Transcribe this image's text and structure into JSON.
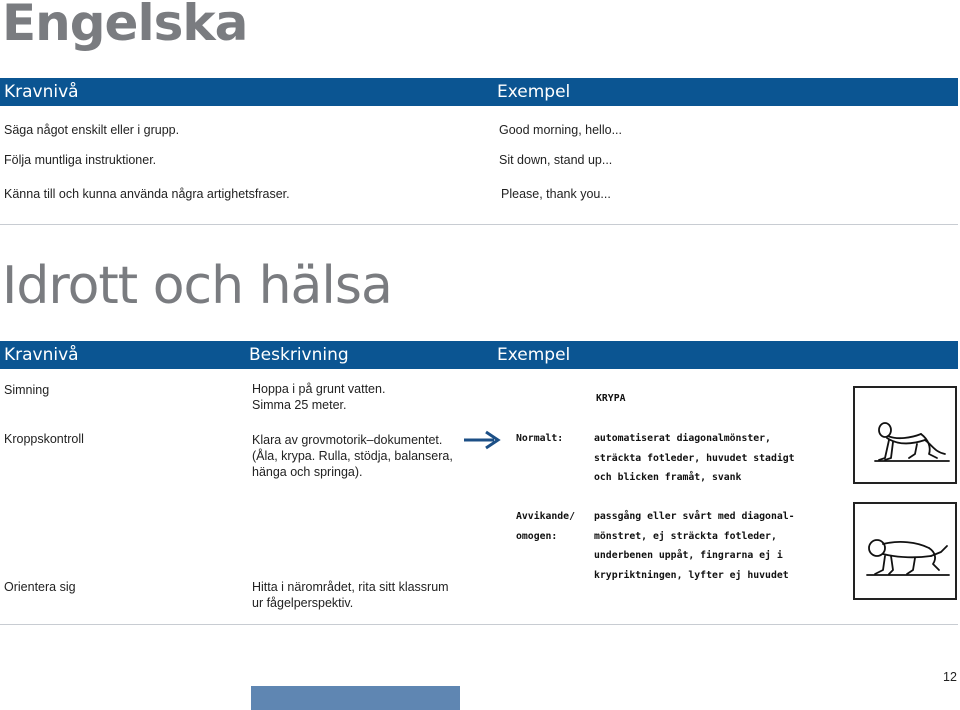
{
  "engelska": {
    "title": "Engelska",
    "headers": {
      "level": "Kravnivå",
      "example": "Exempel"
    },
    "rows": [
      {
        "level": "Säga något enskilt eller i grupp.",
        "example": "Good morning, hello..."
      },
      {
        "level": "Följa muntliga instruktioner.",
        "example": "Sit down, stand up..."
      },
      {
        "level": "Känna till och kunna använda några artighetsfraser.",
        "example": "Please, thank you..."
      }
    ]
  },
  "idrott": {
    "title": "Idrott och hälsa",
    "headers": {
      "level": "Kravnivå",
      "description": "Beskrivning",
      "example": "Exempel"
    },
    "rows": [
      {
        "level": "Simning",
        "description": [
          "Hoppa i på grunt vatten.",
          "Simma 25 meter."
        ]
      },
      {
        "level": "Kroppskontroll",
        "description": [
          "Klara av grovmotorik–dokumentet.",
          "(Åla, krypa. Rulla, stödja, balansera,",
          "hänga och springa)."
        ]
      },
      {
        "level": "Orientera sig",
        "description": [
          "Hitta i närområdet, rita sitt klassrum",
          "ur fågelperspektiv."
        ]
      }
    ],
    "example_doc": {
      "heading": "KRYPA",
      "normal_label": "Normalt:",
      "normal_lines": [
        "automatiserat diagonalmönster,",
        "sträckta fotleder, huvudet stadigt",
        "och blicken framåt, svank"
      ],
      "deviant_label": [
        "Avvikande/",
        "omogen:"
      ],
      "deviant_lines": [
        "passgång eller svårt med diagonal-",
        "mönstret, ej sträckta fotleder,",
        "underbenen uppåt, fingrarna ej i",
        "krypriktningen, lyfter ej huvudet"
      ]
    }
  },
  "page_number": "12",
  "colors": {
    "header_bar": "#0b5592",
    "title_gray": "#7a7c80",
    "arrow": "#1c4f86"
  }
}
